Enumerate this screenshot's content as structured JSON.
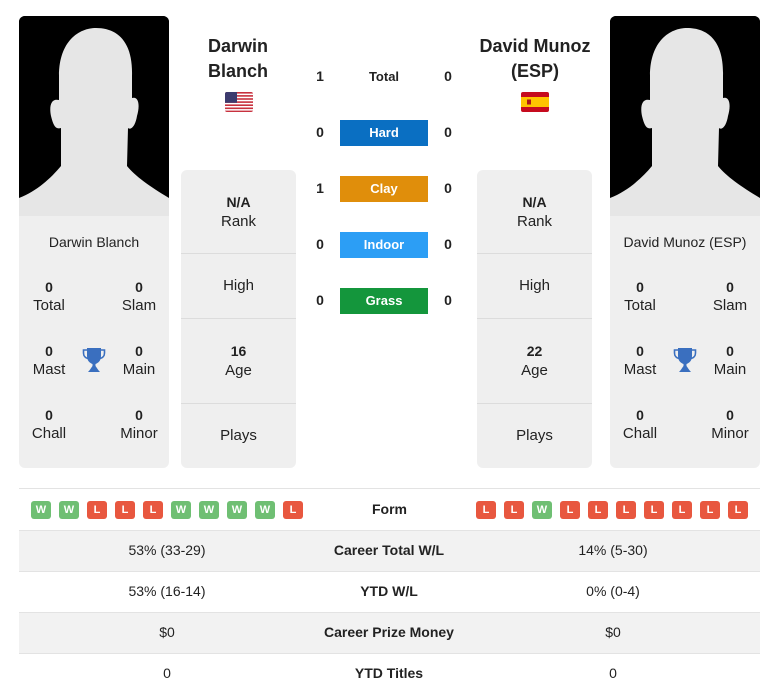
{
  "colors": {
    "hard": "#0a6fc2",
    "clay": "#e08e0b",
    "indoor": "#2c9ef5",
    "grass": "#14963c",
    "win": "#6fbf73",
    "loss": "#e8573f",
    "trophy": "#3a6fbf"
  },
  "players": {
    "left": {
      "name_line1": "Darwin",
      "name_line2": "Blanch",
      "full_name": "Darwin Blanch",
      "flag": "USA",
      "titles": {
        "total": "0",
        "slam": "0",
        "mast": "0",
        "main": "0",
        "chall": "0",
        "minor": "0"
      },
      "rank": "N/A",
      "high": "",
      "age": "16",
      "plays": ""
    },
    "right": {
      "name_line1": "David Munoz",
      "name_line2": "(ESP)",
      "full_name": "David Munoz (ESP)",
      "flag": "ESP",
      "titles": {
        "total": "0",
        "slam": "0",
        "mast": "0",
        "main": "0",
        "chall": "0",
        "minor": "0"
      },
      "rank": "N/A",
      "high": "",
      "age": "22",
      "plays": ""
    }
  },
  "labels": {
    "total": "Total",
    "slam": "Slam",
    "mast": "Mast",
    "main": "Main",
    "chall": "Chall",
    "minor": "Minor",
    "rank": "Rank",
    "high": "High",
    "age": "Age",
    "plays": "Plays"
  },
  "h2h": [
    {
      "surface": "Total",
      "left": "1",
      "right": "0"
    },
    {
      "surface": "Hard",
      "left": "0",
      "right": "0"
    },
    {
      "surface": "Clay",
      "left": "1",
      "right": "0"
    },
    {
      "surface": "Indoor",
      "left": "0",
      "right": "0"
    },
    {
      "surface": "Grass",
      "left": "0",
      "right": "0"
    }
  ],
  "form": {
    "label": "Form",
    "left": [
      "W",
      "W",
      "L",
      "L",
      "L",
      "W",
      "W",
      "W",
      "W",
      "L"
    ],
    "right": [
      "L",
      "L",
      "W",
      "L",
      "L",
      "L",
      "L",
      "L",
      "L",
      "L"
    ]
  },
  "stats": [
    {
      "label": "Career Total W/L",
      "left": "53% (33-29)",
      "right": "14% (5-30)"
    },
    {
      "label": "YTD W/L",
      "left": "53% (16-14)",
      "right": "0% (0-4)"
    },
    {
      "label": "Career Prize Money",
      "left": "$0",
      "right": "$0"
    },
    {
      "label": "YTD Titles",
      "left": "0",
      "right": "0"
    }
  ]
}
